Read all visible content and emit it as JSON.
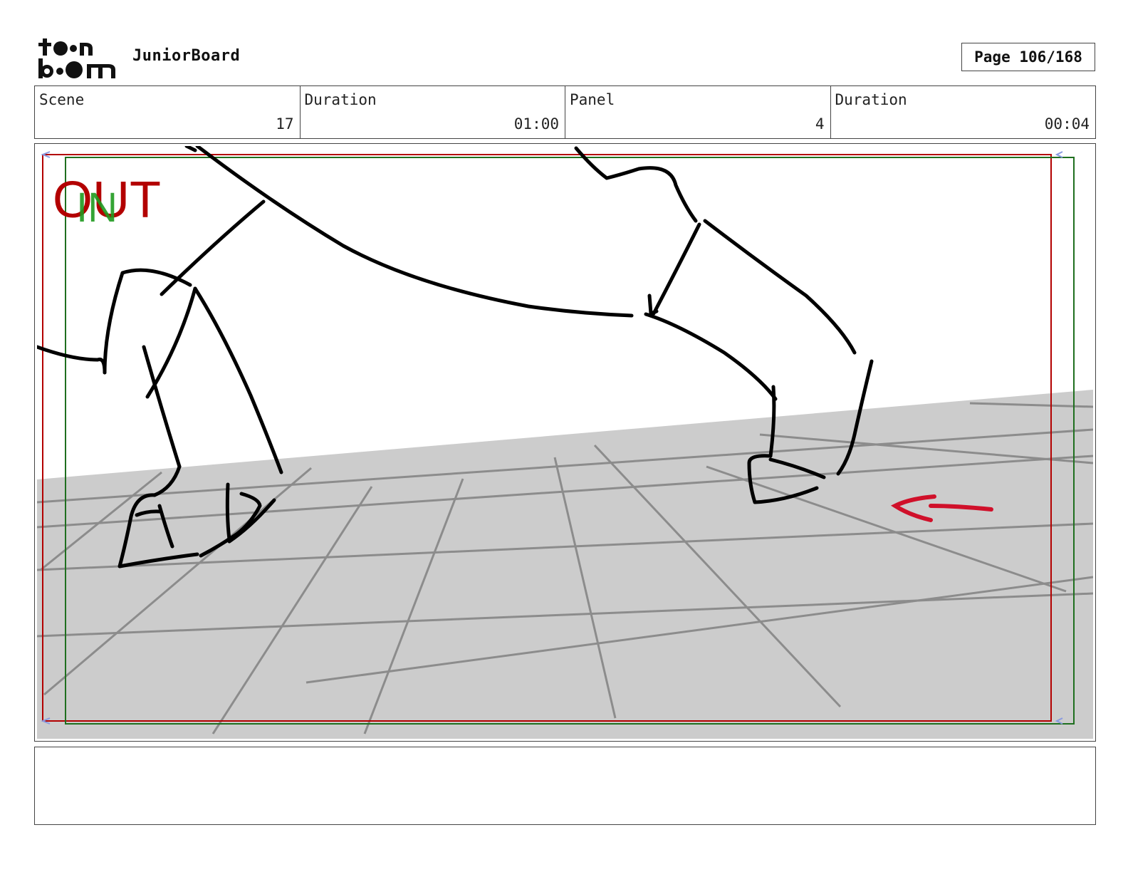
{
  "header": {
    "logo_text": "toon boom",
    "app_title": "JuniorBoard",
    "page_label": "Page 106/168"
  },
  "info": {
    "scene_label": "Scene",
    "scene_value": "17",
    "scene_duration_label": "Duration",
    "scene_duration_value": "01:00",
    "panel_label": "Panel",
    "panel_value": "4",
    "panel_duration_label": "Duration",
    "panel_duration_value": "00:04"
  },
  "frame": {
    "out_label": "OUT",
    "in_label": "IN",
    "out_color": "#b30000",
    "in_color": "#1f8a1f",
    "arrow_color": "#d0102a",
    "floor_color": "#cccccc"
  },
  "notes": {
    "text": ""
  }
}
